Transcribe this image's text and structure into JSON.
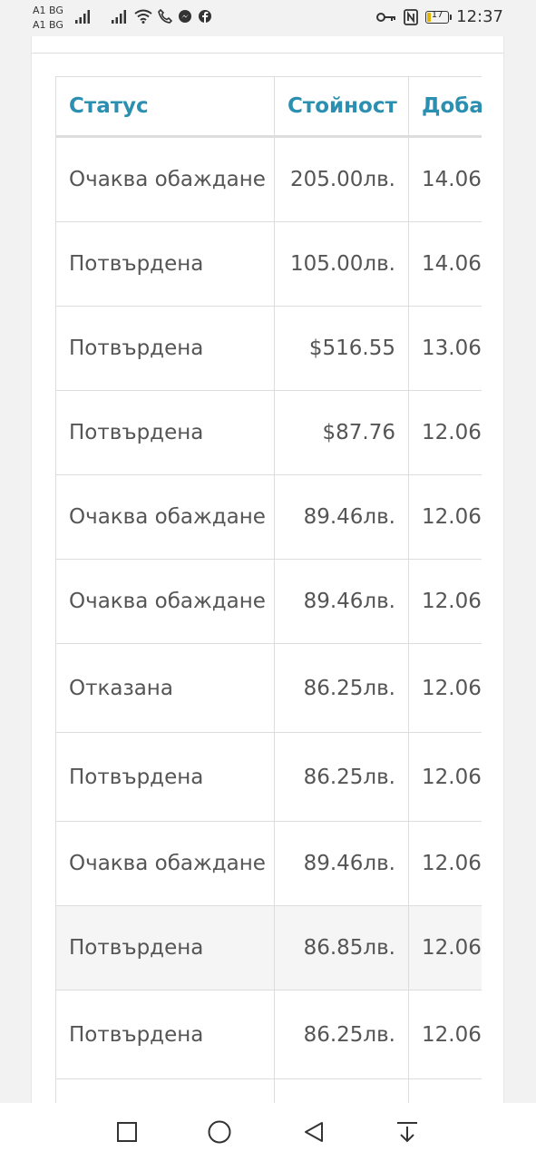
{
  "status_bar": {
    "carrier1": "A1 BG",
    "carrier2": "A1 BG",
    "battery_level": "17",
    "battery_fraction": 0.17,
    "time": "12:37",
    "icons": [
      "signal-icon",
      "signal-icon",
      "wifi-icon",
      "volte-call-icon",
      "messenger-icon",
      "facebook-icon",
      "key-icon",
      "nfc-icon",
      "battery-icon"
    ]
  },
  "table": {
    "headers": {
      "status": "Статус",
      "value": "Стойност",
      "date": "Доба"
    },
    "rows": [
      {
        "status": "Очаква обаждане",
        "value": "205.00лв.",
        "date": "14.06."
      },
      {
        "status": "Потвърдена",
        "value": "105.00лв.",
        "date": "14.06."
      },
      {
        "status": "Потвърдена",
        "value": "$516.55",
        "date": "13.06."
      },
      {
        "status": "Потвърдена",
        "value": "$87.76",
        "date": "12.06."
      },
      {
        "status": "Очаква обаждане",
        "value": "89.46лв.",
        "date": "12.06."
      },
      {
        "status": "Очаква обаждане",
        "value": "89.46лв.",
        "date": "12.06."
      },
      {
        "status": "Отказана",
        "value": "86.25лв.",
        "date": "12.06."
      },
      {
        "status": "Потвърдена",
        "value": "86.25лв.",
        "date": "12.06."
      },
      {
        "status": "Очаква обаждане",
        "value": "89.46лв.",
        "date": "12.06."
      },
      {
        "status": "Потвърдена",
        "value": "86.85лв.",
        "date": "12.06."
      },
      {
        "status": "Потвърдена",
        "value": "86.25лв.",
        "date": "12.06."
      },
      {
        "status": "",
        "value": "",
        "date": ""
      }
    ]
  },
  "nav_bar": {
    "icons": [
      "square-recents-icon",
      "circle-home-icon",
      "triangle-back-icon",
      "notification-pulldown-icon"
    ]
  },
  "colors": {
    "header_text": "#2a8fb0",
    "cell_text": "#555555",
    "border": "#dddddd",
    "highlight_row": "#f5f5f5",
    "battery": "#e0b400"
  }
}
